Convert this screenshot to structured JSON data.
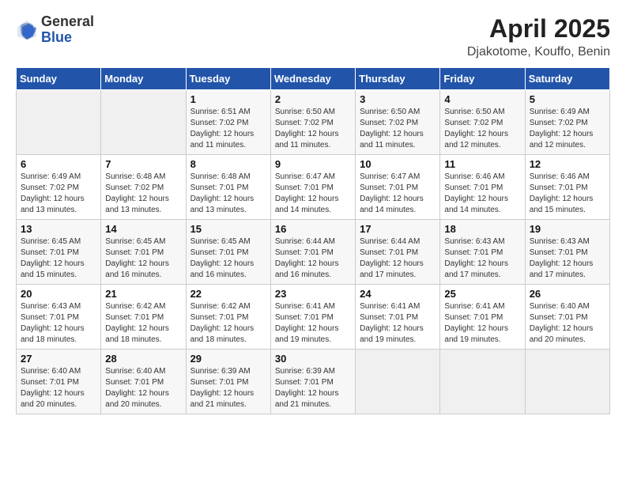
{
  "logo": {
    "general": "General",
    "blue": "Blue"
  },
  "header": {
    "title": "April 2025",
    "subtitle": "Djakotome, Kouffo, Benin"
  },
  "columns": [
    "Sunday",
    "Monday",
    "Tuesday",
    "Wednesday",
    "Thursday",
    "Friday",
    "Saturday"
  ],
  "weeks": [
    [
      {
        "num": "",
        "info": ""
      },
      {
        "num": "",
        "info": ""
      },
      {
        "num": "1",
        "info": "Sunrise: 6:51 AM\nSunset: 7:02 PM\nDaylight: 12 hours and 11 minutes."
      },
      {
        "num": "2",
        "info": "Sunrise: 6:50 AM\nSunset: 7:02 PM\nDaylight: 12 hours and 11 minutes."
      },
      {
        "num": "3",
        "info": "Sunrise: 6:50 AM\nSunset: 7:02 PM\nDaylight: 12 hours and 11 minutes."
      },
      {
        "num": "4",
        "info": "Sunrise: 6:50 AM\nSunset: 7:02 PM\nDaylight: 12 hours and 12 minutes."
      },
      {
        "num": "5",
        "info": "Sunrise: 6:49 AM\nSunset: 7:02 PM\nDaylight: 12 hours and 12 minutes."
      }
    ],
    [
      {
        "num": "6",
        "info": "Sunrise: 6:49 AM\nSunset: 7:02 PM\nDaylight: 12 hours and 13 minutes."
      },
      {
        "num": "7",
        "info": "Sunrise: 6:48 AM\nSunset: 7:02 PM\nDaylight: 12 hours and 13 minutes."
      },
      {
        "num": "8",
        "info": "Sunrise: 6:48 AM\nSunset: 7:01 PM\nDaylight: 12 hours and 13 minutes."
      },
      {
        "num": "9",
        "info": "Sunrise: 6:47 AM\nSunset: 7:01 PM\nDaylight: 12 hours and 14 minutes."
      },
      {
        "num": "10",
        "info": "Sunrise: 6:47 AM\nSunset: 7:01 PM\nDaylight: 12 hours and 14 minutes."
      },
      {
        "num": "11",
        "info": "Sunrise: 6:46 AM\nSunset: 7:01 PM\nDaylight: 12 hours and 14 minutes."
      },
      {
        "num": "12",
        "info": "Sunrise: 6:46 AM\nSunset: 7:01 PM\nDaylight: 12 hours and 15 minutes."
      }
    ],
    [
      {
        "num": "13",
        "info": "Sunrise: 6:45 AM\nSunset: 7:01 PM\nDaylight: 12 hours and 15 minutes."
      },
      {
        "num": "14",
        "info": "Sunrise: 6:45 AM\nSunset: 7:01 PM\nDaylight: 12 hours and 16 minutes."
      },
      {
        "num": "15",
        "info": "Sunrise: 6:45 AM\nSunset: 7:01 PM\nDaylight: 12 hours and 16 minutes."
      },
      {
        "num": "16",
        "info": "Sunrise: 6:44 AM\nSunset: 7:01 PM\nDaylight: 12 hours and 16 minutes."
      },
      {
        "num": "17",
        "info": "Sunrise: 6:44 AM\nSunset: 7:01 PM\nDaylight: 12 hours and 17 minutes."
      },
      {
        "num": "18",
        "info": "Sunrise: 6:43 AM\nSunset: 7:01 PM\nDaylight: 12 hours and 17 minutes."
      },
      {
        "num": "19",
        "info": "Sunrise: 6:43 AM\nSunset: 7:01 PM\nDaylight: 12 hours and 17 minutes."
      }
    ],
    [
      {
        "num": "20",
        "info": "Sunrise: 6:43 AM\nSunset: 7:01 PM\nDaylight: 12 hours and 18 minutes."
      },
      {
        "num": "21",
        "info": "Sunrise: 6:42 AM\nSunset: 7:01 PM\nDaylight: 12 hours and 18 minutes."
      },
      {
        "num": "22",
        "info": "Sunrise: 6:42 AM\nSunset: 7:01 PM\nDaylight: 12 hours and 18 minutes."
      },
      {
        "num": "23",
        "info": "Sunrise: 6:41 AM\nSunset: 7:01 PM\nDaylight: 12 hours and 19 minutes."
      },
      {
        "num": "24",
        "info": "Sunrise: 6:41 AM\nSunset: 7:01 PM\nDaylight: 12 hours and 19 minutes."
      },
      {
        "num": "25",
        "info": "Sunrise: 6:41 AM\nSunset: 7:01 PM\nDaylight: 12 hours and 19 minutes."
      },
      {
        "num": "26",
        "info": "Sunrise: 6:40 AM\nSunset: 7:01 PM\nDaylight: 12 hours and 20 minutes."
      }
    ],
    [
      {
        "num": "27",
        "info": "Sunrise: 6:40 AM\nSunset: 7:01 PM\nDaylight: 12 hours and 20 minutes."
      },
      {
        "num": "28",
        "info": "Sunrise: 6:40 AM\nSunset: 7:01 PM\nDaylight: 12 hours and 20 minutes."
      },
      {
        "num": "29",
        "info": "Sunrise: 6:39 AM\nSunset: 7:01 PM\nDaylight: 12 hours and 21 minutes."
      },
      {
        "num": "30",
        "info": "Sunrise: 6:39 AM\nSunset: 7:01 PM\nDaylight: 12 hours and 21 minutes."
      },
      {
        "num": "",
        "info": ""
      },
      {
        "num": "",
        "info": ""
      },
      {
        "num": "",
        "info": ""
      }
    ]
  ]
}
